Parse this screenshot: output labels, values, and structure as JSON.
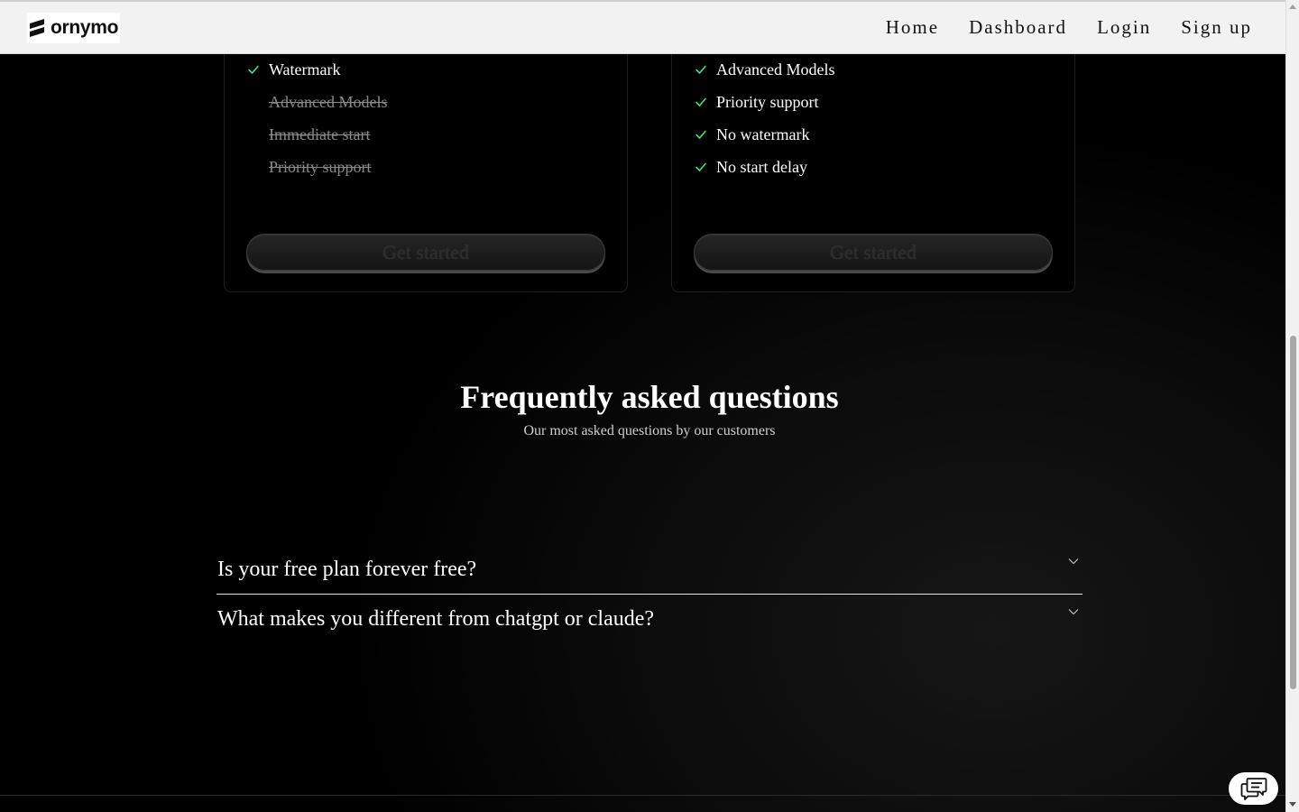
{
  "navbar": {
    "logo_text": "ornymo",
    "links": [
      "Home",
      "Dashboard",
      "Login",
      "Sign up"
    ]
  },
  "pricing": {
    "left_card": {
      "features": [
        {
          "label": "Watermark",
          "included": true
        },
        {
          "label": "Advanced Models",
          "included": false
        },
        {
          "label": "Immediate start",
          "included": false
        },
        {
          "label": "Priority support",
          "included": false
        }
      ],
      "cta_label": "Get started"
    },
    "right_card": {
      "features": [
        {
          "label": "Advanced Models",
          "included": true
        },
        {
          "label": "Priority support",
          "included": true
        },
        {
          "label": "No watermark",
          "included": true
        },
        {
          "label": "No start delay",
          "included": true
        }
      ],
      "cta_label": "Get started"
    }
  },
  "faq": {
    "title": "Frequently asked questions",
    "subtitle": "Our most asked questions by our customers",
    "items": [
      {
        "question": "Is your free plan forever free?"
      },
      {
        "question": "What makes you different from chatgpt or claude?"
      }
    ]
  },
  "colors": {
    "check": "#4ade80",
    "background": "#000000",
    "navbar": "#f2f2f2"
  },
  "icons": {
    "logo": "ornymo-logo-mark",
    "check": "check-icon",
    "chevron": "chevron-down-icon",
    "chat": "chat-bubbles-icon"
  }
}
